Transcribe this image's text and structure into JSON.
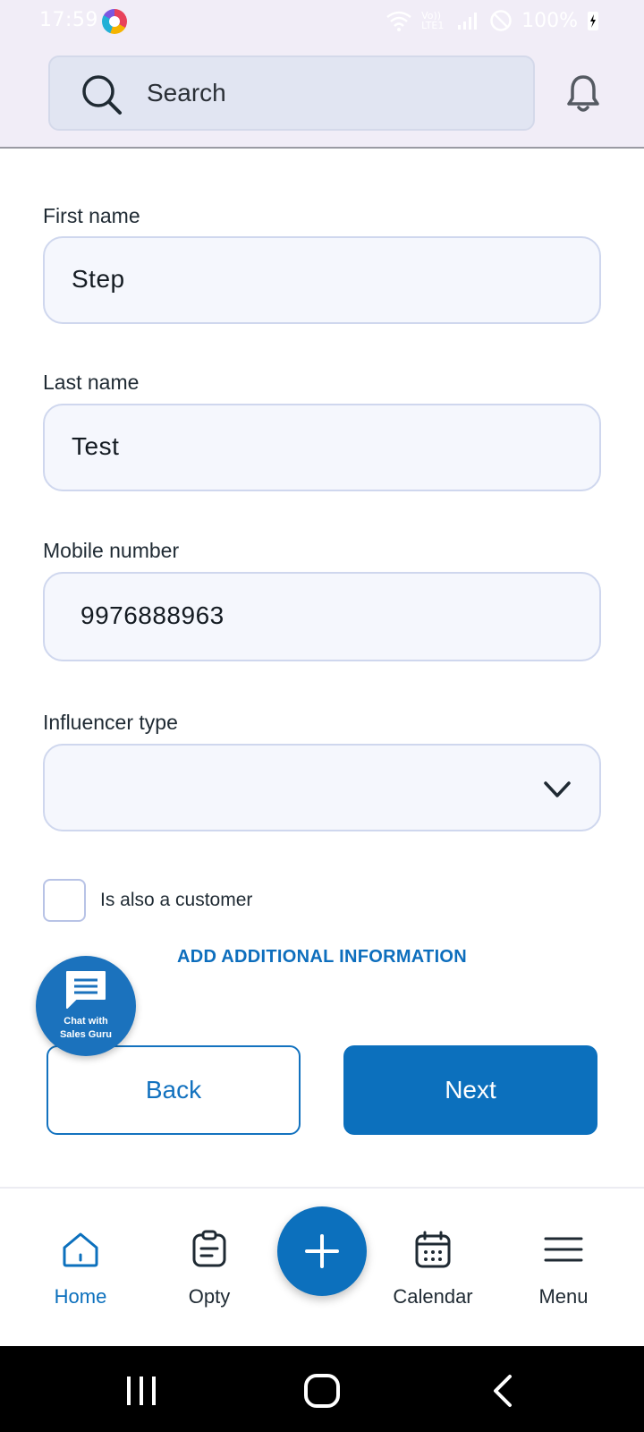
{
  "status_bar": {
    "time": "17:59",
    "network": "Vo)) LTE1",
    "battery": "100%"
  },
  "search": {
    "placeholder": "Search"
  },
  "form": {
    "first_name": {
      "label": "First name",
      "value": "Step"
    },
    "last_name": {
      "label": "Last name",
      "value": "Test"
    },
    "mobile": {
      "label": "Mobile number",
      "value": "9976888963"
    },
    "influencer_type": {
      "label": "Influencer type",
      "value": ""
    },
    "customer_checkbox": {
      "label": "Is also a customer",
      "checked": false
    },
    "add_info_link": "ADD ADDITIONAL INFORMATION"
  },
  "buttons": {
    "back": "Back",
    "next": "Next"
  },
  "chat_fab": {
    "line1": "Chat with",
    "line2": "Sales Guru"
  },
  "bottom_nav": {
    "items": [
      {
        "label": "Home",
        "icon": "home-icon",
        "active": true
      },
      {
        "label": "Opty",
        "icon": "clipboard-icon",
        "active": false
      },
      {
        "label": "Calendar",
        "icon": "calendar-icon",
        "active": false
      },
      {
        "label": "Menu",
        "icon": "menu-icon",
        "active": false
      }
    ],
    "fab_icon": "plus-icon"
  },
  "colors": {
    "primary": "#0c70bd",
    "topbar": "#f1edf7",
    "field_bg": "#f5f7fd",
    "field_border": "#cfd7ee"
  }
}
